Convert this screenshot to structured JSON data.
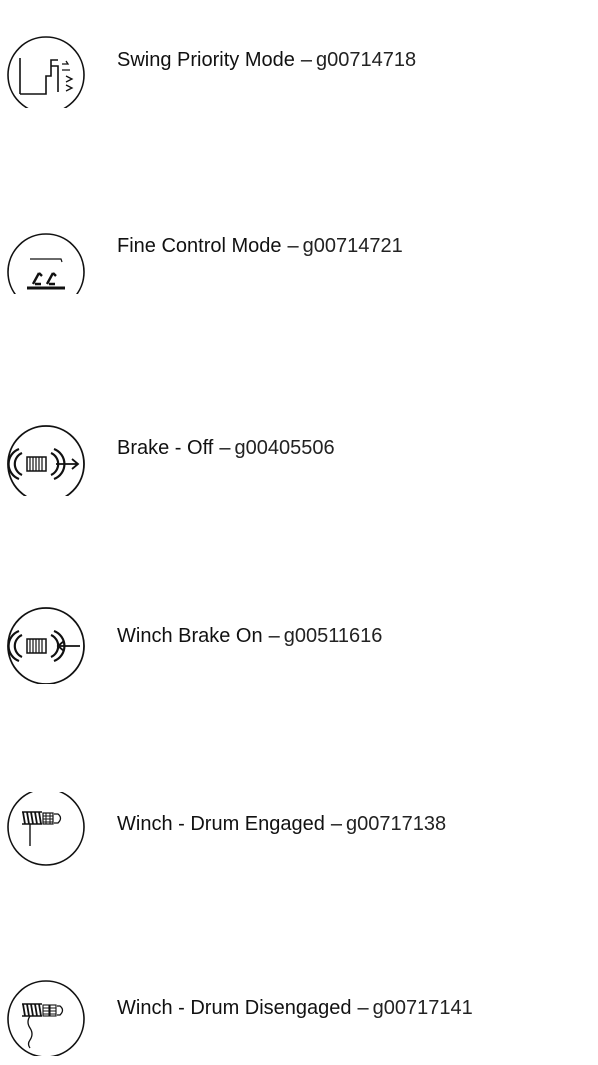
{
  "entries": [
    {
      "label": "Swing Priority Mode",
      "separator": "–",
      "code": "g00714718",
      "icon": "swing-priority-icon"
    },
    {
      "label": "Fine Control Mode",
      "separator": "–",
      "code": "g00714721",
      "icon": "fine-control-icon"
    },
    {
      "label": "Brake - Off",
      "separator": "–",
      "code": "g00405506",
      "icon": "brake-off-icon"
    },
    {
      "label": "Winch Brake On",
      "separator": "–",
      "code": "g00511616",
      "icon": "winch-brake-on-icon"
    },
    {
      "label": "Winch - Drum Engaged",
      "separator": "–",
      "code": "g00717138",
      "icon": "winch-drum-engaged-icon"
    },
    {
      "label": "Winch - Drum Disengaged",
      "separator": "–",
      "code": "g00717141",
      "icon": "winch-drum-disengaged-icon"
    }
  ]
}
